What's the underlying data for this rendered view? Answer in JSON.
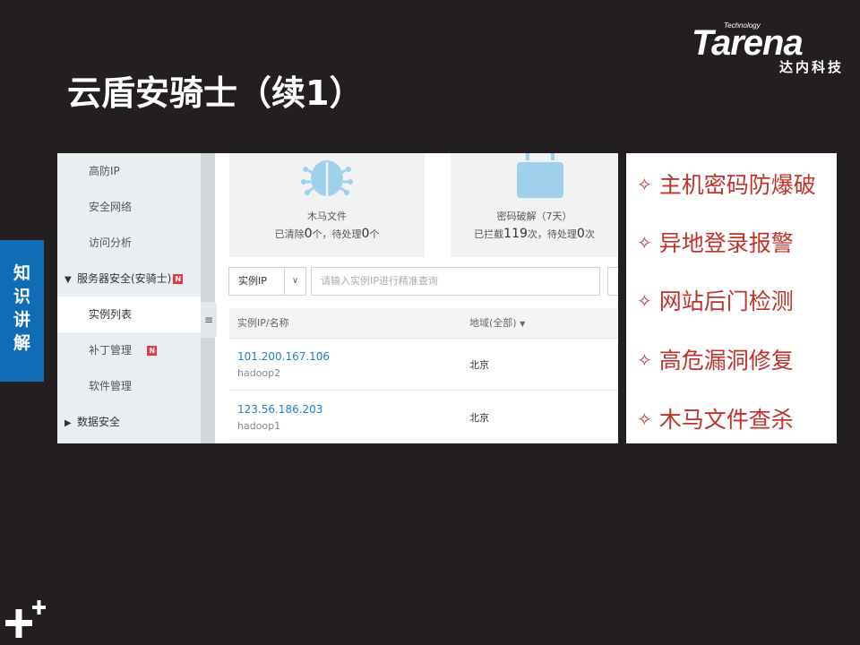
{
  "brand": {
    "name": "Tarena",
    "sub": "Technology",
    "chinese": "达内科技"
  },
  "title": "云盾安骑士（续1）",
  "side_tab": [
    "知",
    "识",
    "讲",
    "解"
  ],
  "nav": {
    "items": [
      {
        "label": "高防IP"
      },
      {
        "label": "安全网络"
      },
      {
        "label": "访问分析"
      },
      {
        "label": "服务器安全(安骑士)",
        "badge": "N"
      },
      {
        "label": "实例列表"
      },
      {
        "label": "补丁管理",
        "badge": "N"
      },
      {
        "label": "软件管理"
      },
      {
        "label": "数据安全"
      }
    ],
    "collapse_icon": "≡"
  },
  "cards": [
    {
      "icon": "bug-icon",
      "label": "木马文件",
      "stat_prefix": "已清除",
      "stat_num": "0",
      "stat_mid": "个，待处理",
      "stat_num2": "0",
      "stat_suffix": "个"
    },
    {
      "icon": "lock-icon",
      "label": "密码破解（7天）",
      "stat_prefix": "已拦截",
      "stat_num": "119",
      "stat_mid": "次，待处理",
      "stat_num2": "0",
      "stat_suffix": "次"
    }
  ],
  "filter": {
    "select_value": "实例IP",
    "placeholder": "请输入实例IP进行精准查询"
  },
  "table": {
    "headers": [
      "实例IP/名称",
      "地域(全部)"
    ],
    "rows": [
      {
        "ip": "101.200.167.106",
        "host": "hadoop2",
        "region": "北京"
      },
      {
        "ip": "123.56.186.203",
        "host": "hadoop1",
        "region": "北京"
      }
    ]
  },
  "features": [
    "主机密码防爆破",
    "异地登录报警",
    "网站后门检测",
    "高危漏洞修复",
    "木马文件查杀"
  ],
  "colors": {
    "background": "#231f20",
    "accent_blue": "#0f6db5",
    "feature_red": "#c0332b",
    "link_blue": "#1e7fd0"
  }
}
